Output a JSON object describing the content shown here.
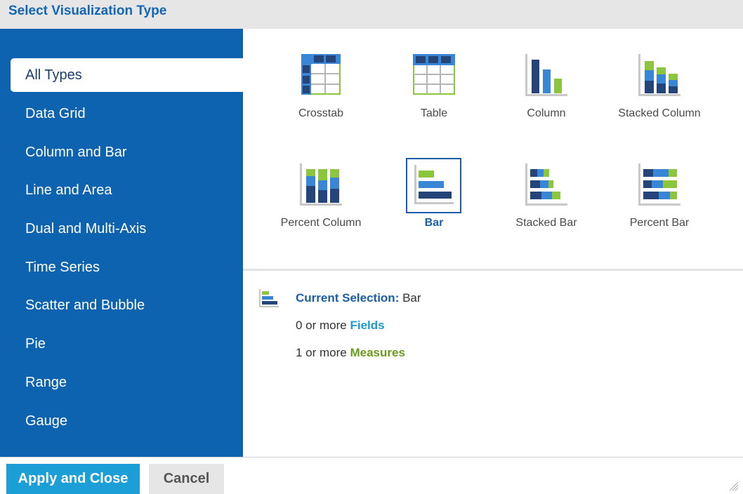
{
  "dialog": {
    "title": "Select Visualization Type"
  },
  "sidebar": {
    "items": [
      {
        "label": "All Types",
        "active": true
      },
      {
        "label": "Data Grid"
      },
      {
        "label": "Column and Bar"
      },
      {
        "label": "Line and Area"
      },
      {
        "label": "Dual and Multi-Axis"
      },
      {
        "label": "Time Series"
      },
      {
        "label": "Scatter and Bubble"
      },
      {
        "label": "Pie"
      },
      {
        "label": "Range"
      },
      {
        "label": "Gauge"
      }
    ]
  },
  "types": [
    {
      "label": "Crosstab",
      "icon": "crosstab-icon"
    },
    {
      "label": "Table",
      "icon": "table-icon"
    },
    {
      "label": "Column",
      "icon": "column-chart-icon"
    },
    {
      "label": "Stacked Column",
      "icon": "stacked-column-icon"
    },
    {
      "label": "Percent Column",
      "icon": "percent-column-icon"
    },
    {
      "label": "Bar",
      "icon": "bar-chart-icon",
      "selected": true
    },
    {
      "label": "Stacked Bar",
      "icon": "stacked-bar-icon"
    },
    {
      "label": "Percent Bar",
      "icon": "percent-bar-icon"
    }
  ],
  "details": {
    "current_label": "Current Selection:",
    "current_value": "Bar",
    "fields_prefix": "0 or more",
    "fields_label": "Fields",
    "measures_prefix": "1 or more",
    "measures_label": "Measures"
  },
  "footer": {
    "apply_label": "Apply and Close",
    "cancel_label": "Cancel"
  },
  "colors": {
    "sidebar": "#0d63b0",
    "accent_blue": "#1a5ea8",
    "chart_dark": "#25447a",
    "chart_mid": "#3a86d6",
    "chart_green": "#8cc63f",
    "apply_button": "#1b9fd6"
  }
}
